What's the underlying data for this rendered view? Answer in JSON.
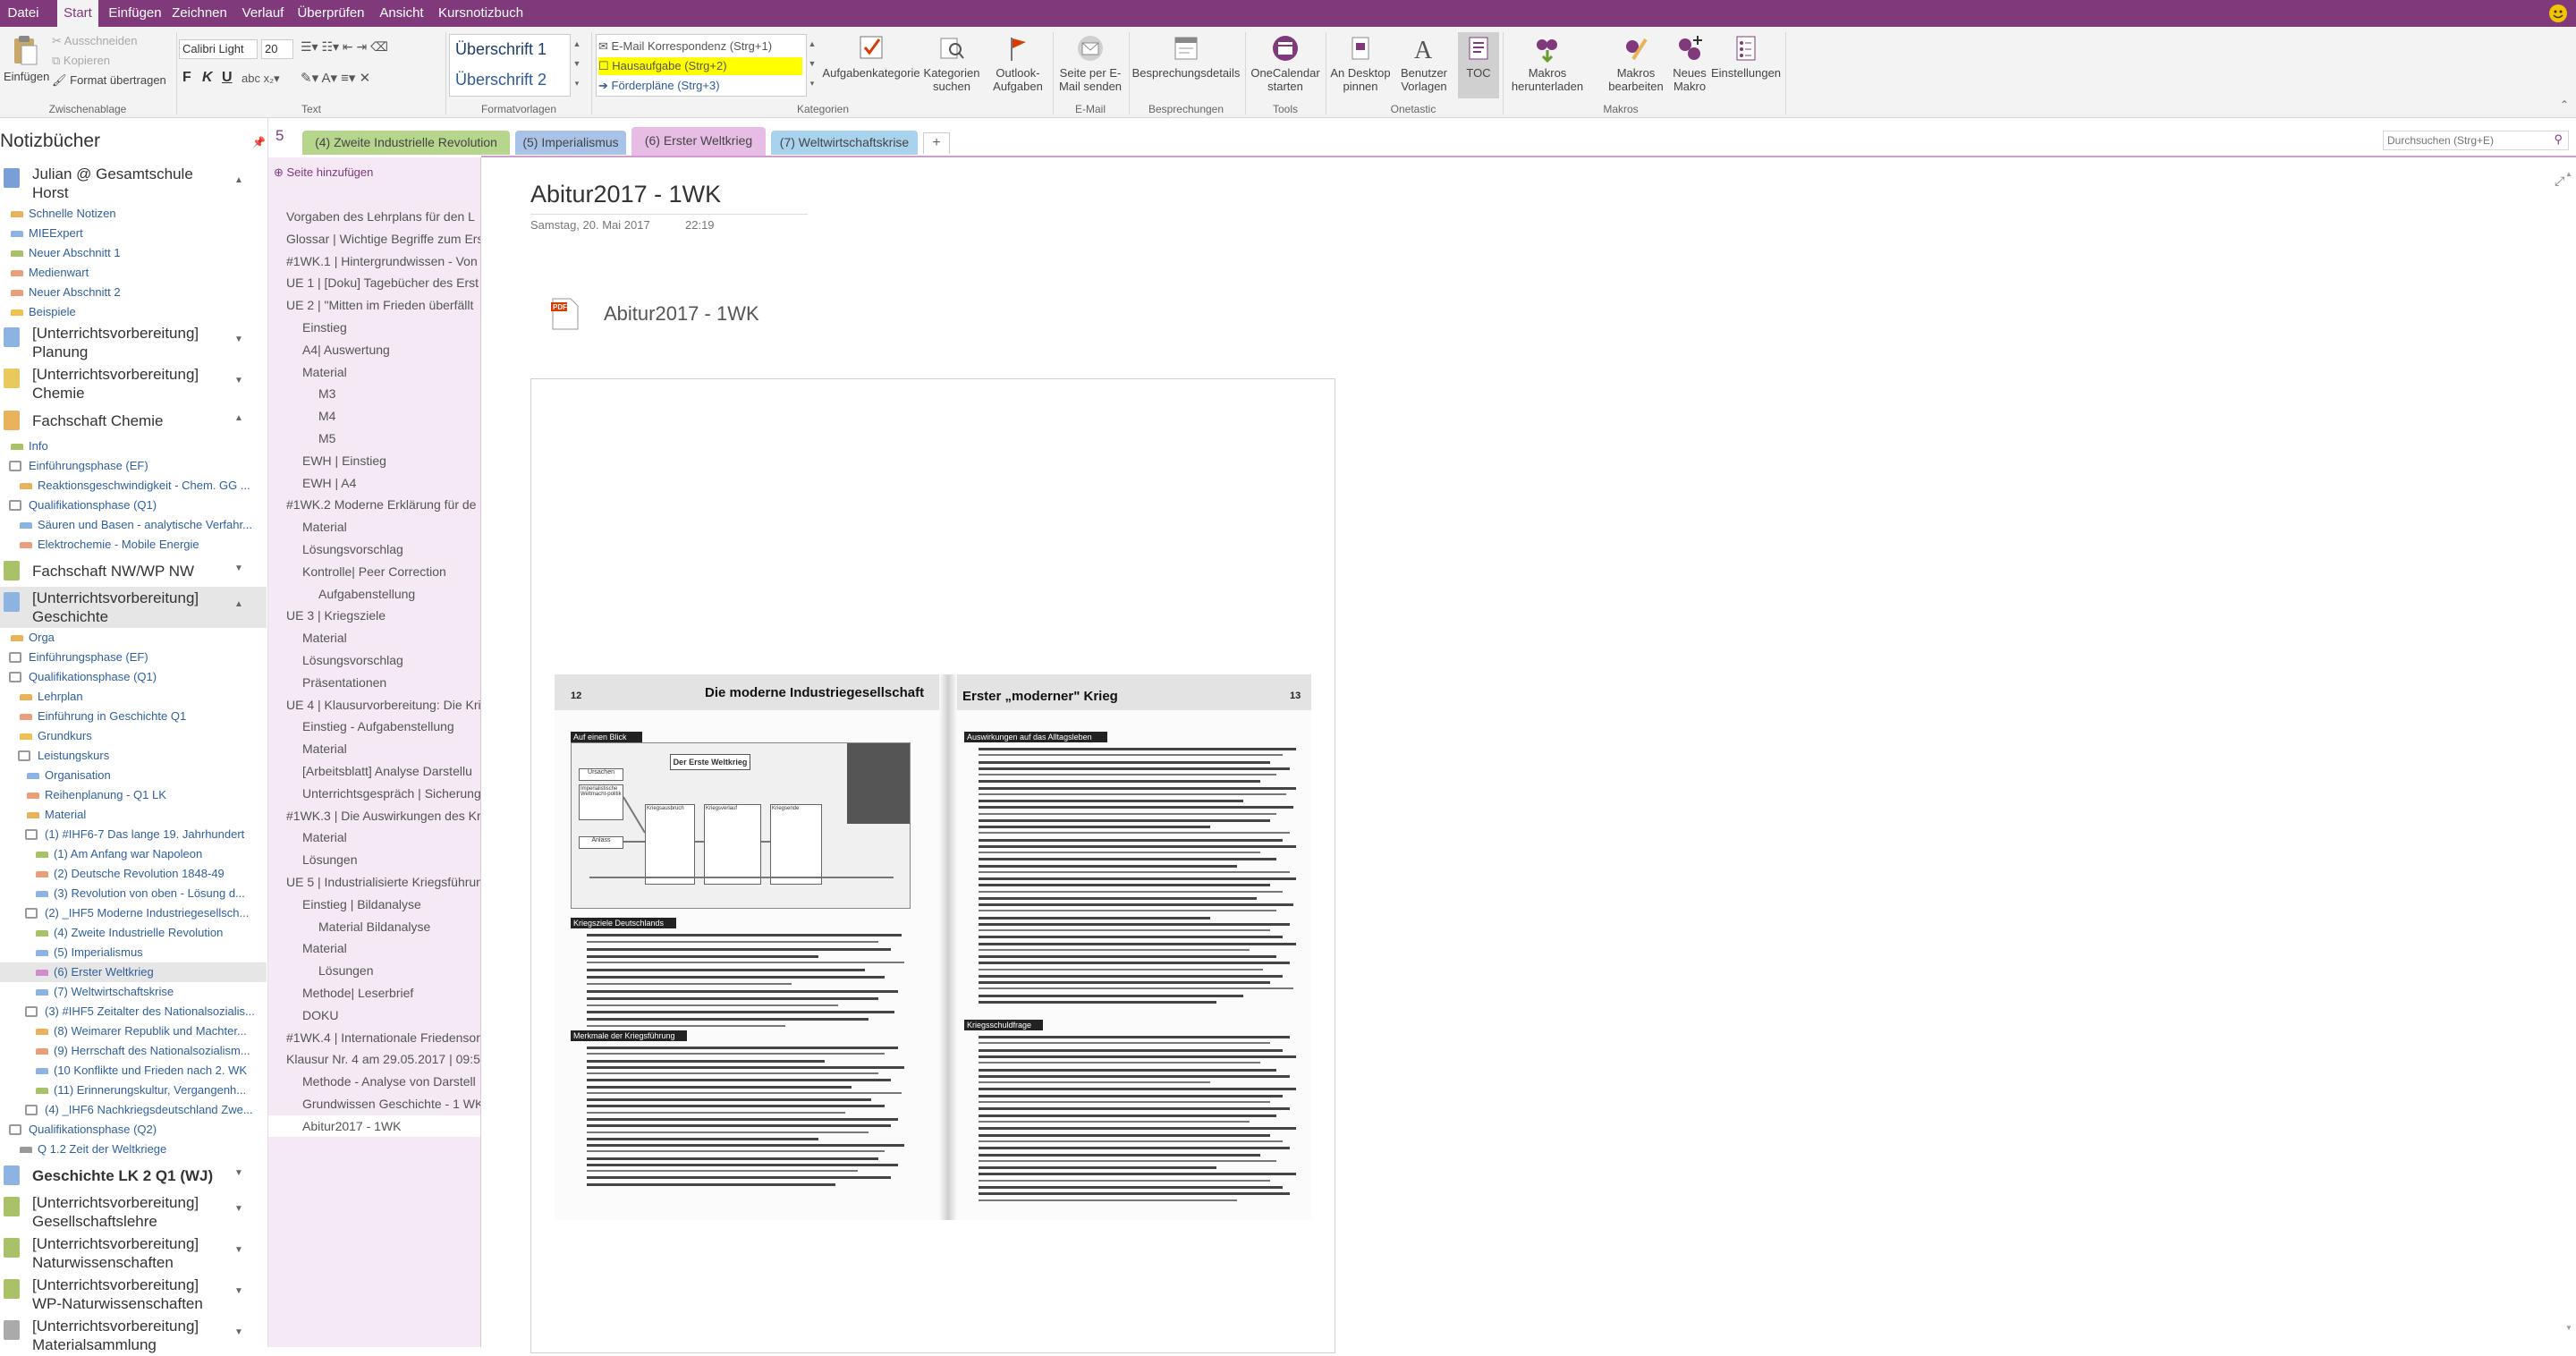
{
  "menu": {
    "tabs": [
      "Datei",
      "Start",
      "Einfügen",
      "Zeichnen",
      "Verlauf",
      "Überprüfen",
      "Ansicht",
      "Kursnotizbuch"
    ]
  },
  "ribbon": {
    "clipboard": {
      "paste": "Einfügen",
      "cut": "Ausschneiden",
      "copy": "Kopieren",
      "format_painter": "Format übertragen",
      "label": "Zwischenablage"
    },
    "text": {
      "font": "Calibri Light",
      "size": "20",
      "label": "Text"
    },
    "styles": {
      "h1": "Überschrift 1",
      "h2": "Überschrift 2",
      "label": "Formatvorlagen"
    },
    "tags": {
      "items": [
        "E-Mail Korrespondenz (Strg+1)",
        "Hausaufgabe (Strg+2)",
        "Förderpläne (Strg+3)"
      ],
      "task_tag": "Aufgabenkategorie",
      "find_tags": "Kategorien suchen",
      "outlook": "Outlook-Aufgaben",
      "label": "Kategorien"
    },
    "email": {
      "send": "Seite per E-Mail senden",
      "label": "E-Mail"
    },
    "meetings": {
      "details": "Besprechungsdetails",
      "label": "Besprechungen"
    },
    "tools": {
      "calendar": "OneCalendar starten",
      "label": "Tools"
    },
    "onetastic": {
      "pin": "An Desktop pinnen",
      "custom": "Benutzer Vorlagen",
      "toc": "TOC",
      "label": "Onetastic"
    },
    "macros": {
      "download": "Makros herunterladen",
      "edit": "Makros bearbeiten",
      "new": "Neues Makro",
      "settings": "Einstellungen",
      "label": "Makros"
    }
  },
  "notebooks": {
    "title": "Notizbücher",
    "items": [
      {
        "label": "Julian @ Gesamtschule Horst",
        "kind": "notebook",
        "color": "#7a9fd6",
        "chev": "▲"
      },
      {
        "label": "Schnelle Notizen",
        "kind": "section",
        "color": "#e9b25d"
      },
      {
        "label": "MIEExpert",
        "kind": "section",
        "color": "#8db3e2"
      },
      {
        "label": "Neuer Abschnitt 1",
        "kind": "section",
        "color": "#a9c26a"
      },
      {
        "label": "Medienwart",
        "kind": "section",
        "color": "#e9a07a"
      },
      {
        "label": "Neuer Abschnitt 2",
        "kind": "section",
        "color": "#e9a07a"
      },
      {
        "label": "Beispiele",
        "kind": "section",
        "color": "#f0c050"
      },
      {
        "label": "[Unterrichtsvorbereitung] Planung",
        "kind": "notebook",
        "color": "#8db3e2",
        "chev": "▼"
      },
      {
        "label": "[Unterrichtsvorbereitung] Chemie",
        "kind": "notebook",
        "color": "#e9c85d",
        "chev": "▼"
      },
      {
        "label": "Fachschaft Chemie",
        "kind": "notebook",
        "color": "#e9b25d",
        "chev": "▲"
      },
      {
        "label": "Info",
        "kind": "section",
        "color": "#a9c26a"
      },
      {
        "label": "Einführungsphase (EF)",
        "kind": "group",
        "color": "#999"
      },
      {
        "label": "Reaktionsgeschwindigkeit - Chem. GG ...",
        "kind": "sub",
        "color": "#e9b25d"
      },
      {
        "label": "Qualifikationsphase (Q1)",
        "kind": "group",
        "color": "#999"
      },
      {
        "label": "Säuren und Basen - analytische Verfahr...",
        "kind": "sub",
        "color": "#8db3e2"
      },
      {
        "label": "Elektrochemie - Mobile Energie",
        "kind": "sub",
        "color": "#e9a07a"
      },
      {
        "label": "Fachschaft NW/WP NW",
        "kind": "notebook",
        "color": "#a9c26a",
        "chev": "▼"
      },
      {
        "label": "[Unterrichtsvorbereitung] Geschichte",
        "kind": "notebook",
        "color": "#8db3e2",
        "chev": "▲"
      },
      {
        "label": "Orga",
        "kind": "section",
        "color": "#e9b25d"
      },
      {
        "label": "Einführungsphase (EF)",
        "kind": "group",
        "color": "#999"
      },
      {
        "label": "Qualifikationsphase (Q1)",
        "kind": "group",
        "color": "#999"
      },
      {
        "label": "Lehrplan",
        "kind": "sub",
        "color": "#e9b25d"
      },
      {
        "label": "Einführung in Geschichte Q1",
        "kind": "sub",
        "color": "#e9a07a"
      },
      {
        "label": "Grundkurs",
        "kind": "sub",
        "color": "#f0c050"
      },
      {
        "label": "Leistungskurs",
        "kind": "subgroup",
        "color": "#999"
      },
      {
        "label": "Organisation",
        "kind": "sub2",
        "color": "#8db3e2"
      },
      {
        "label": "Reihenplanung - Q1 LK",
        "kind": "sub2",
        "color": "#e9a07a"
      },
      {
        "label": "Material",
        "kind": "sub2",
        "color": "#e9b25d"
      },
      {
        "label": "(1) #IHF6-7 Das lange 19. Jahrhundert",
        "kind": "sub2g",
        "color": "#999"
      },
      {
        "label": "(1) Am Anfang war Napoleon",
        "kind": "sub3",
        "color": "#a9c26a"
      },
      {
        "label": "(2) Deutsche Revolution 1848-49",
        "kind": "sub3",
        "color": "#e9a07a"
      },
      {
        "label": "(3) Revolution von oben - Lösung d...",
        "kind": "sub3",
        "color": "#8db3e2"
      },
      {
        "label": "(2) _IHF5 Moderne Industriegesellsch...",
        "kind": "sub2g",
        "color": "#999"
      },
      {
        "label": "(4) Zweite Industrielle Revolution",
        "kind": "sub3",
        "color": "#a9c26a"
      },
      {
        "label": "(5) Imperialismus",
        "kind": "sub3",
        "color": "#8db3e2"
      },
      {
        "label": "(6) Erster Weltkrieg",
        "kind": "sub3",
        "color": "#d08ccf",
        "selected": true
      },
      {
        "label": "(7) Weltwirtschaftskrise",
        "kind": "sub3",
        "color": "#8db3e2"
      },
      {
        "label": "(3) #IHF5 Zeitalter des Nationalsozialis...",
        "kind": "sub2g",
        "color": "#999"
      },
      {
        "label": "(8) Weimarer Republik und Machter...",
        "kind": "sub3",
        "color": "#e9b25d"
      },
      {
        "label": "(9) Herrschaft des Nationalsozialism...",
        "kind": "sub3",
        "color": "#e9a07a"
      },
      {
        "label": "(10 Konflikte und Frieden nach 2. WK",
        "kind": "sub3",
        "color": "#8db3e2"
      },
      {
        "label": "(11) Erinnerungskultur, Vergangenh...",
        "kind": "sub3",
        "color": "#a9c26a"
      },
      {
        "label": "(4) _IHF6 Nachkriegsdeutschland Zwe...",
        "kind": "sub2g",
        "color": "#999"
      },
      {
        "label": "Qualifikationsphase (Q2)",
        "kind": "group",
        "color": "#999"
      },
      {
        "label": "Q 1.2 Zeit der Weltkriege",
        "kind": "sub",
        "color": "#999"
      },
      {
        "label": "Geschichte LK 2 Q1 (WJ)",
        "kind": "notebook",
        "color": "#8db3e2",
        "chev": "▼"
      },
      {
        "label": "[Unterrichtsvorbereitung] Gesellschaftslehre",
        "kind": "notebook",
        "color": "#a9c26a",
        "chev": "▼"
      },
      {
        "label": "[Unterrichtsvorbereitung] Naturwissenschaften",
        "kind": "notebook",
        "color": "#a9c26a",
        "chev": "▼"
      },
      {
        "label": "[Unterrichtsvorbereitung] WP-Naturwissenschaften",
        "kind": "notebook",
        "color": "#a9c26a",
        "chev": "▼"
      },
      {
        "label": "[Unterrichtsvorbereitung] Materialsammlung",
        "kind": "notebook",
        "color": "#aaaaaa",
        "chev": "▼"
      }
    ]
  },
  "section_tabs": [
    {
      "label": "(4) Zweite Industrielle Revolution",
      "color": "#b5d68c"
    },
    {
      "label": "(5) Imperialismus",
      "color": "#a9c2e8"
    },
    {
      "label": "(6) Erster Weltkrieg",
      "color": "#e7bde6",
      "active": true
    },
    {
      "label": "(7) Weltwirtschaftskrise",
      "color": "#a9d2ee"
    }
  ],
  "section_count": "5",
  "add_tab": "+",
  "search": {
    "placeholder": "Durchsuchen (Strg+E)"
  },
  "pages": {
    "add_page": "Seite hinzufügen",
    "items": [
      {
        "label": "Vorgaben des Lehrplans für den L",
        "level": 0
      },
      {
        "label": "Glossar | Wichtige Begriffe zum Ers",
        "level": 0
      },
      {
        "label": "#1WK.1 | Hintergrundwissen - Von",
        "level": 0
      },
      {
        "label": "UE 1 | [Doku] Tagebücher des Erst",
        "level": 0
      },
      {
        "label": "UE 2 | \"Mitten im Frieden überfällt",
        "level": 0
      },
      {
        "label": "Einstieg",
        "level": 1
      },
      {
        "label": "A4| Auswertung",
        "level": 1
      },
      {
        "label": "Material",
        "level": 1
      },
      {
        "label": "M3",
        "level": 2
      },
      {
        "label": "M4",
        "level": 2
      },
      {
        "label": "M5",
        "level": 2
      },
      {
        "label": "EWH | Einstieg",
        "level": 1
      },
      {
        "label": "EWH | A4",
        "level": 1
      },
      {
        "label": "#1WK.2 Moderne Erklärung für de",
        "level": 0
      },
      {
        "label": "Material",
        "level": 1
      },
      {
        "label": "Lösungsvorschlag",
        "level": 1
      },
      {
        "label": "Kontrolle| Peer Correction",
        "level": 1
      },
      {
        "label": "Aufgabenstellung",
        "level": 2
      },
      {
        "label": "UE 3 | Kriegsziele",
        "level": 0
      },
      {
        "label": "Material",
        "level": 1
      },
      {
        "label": "Lösungsvorschlag",
        "level": 1
      },
      {
        "label": "Präsentationen",
        "level": 1
      },
      {
        "label": "UE 4 | Klausurvorbereitung: Die Kri",
        "level": 0
      },
      {
        "label": "Einstieg - Aufgabenstellung",
        "level": 1
      },
      {
        "label": "Material",
        "level": 1
      },
      {
        "label": "[Arbeitsblatt] Analyse Darstellu",
        "level": 1
      },
      {
        "label": "Unterrichtsgespräch | Sicherung",
        "level": 1
      },
      {
        "label": "#1WK.3 | Die Auswirkungen des Kr",
        "level": 0
      },
      {
        "label": "Material",
        "level": 1
      },
      {
        "label": "Lösungen",
        "level": 1
      },
      {
        "label": "UE 5 | Industrialisierte Kriegsführun",
        "level": 0
      },
      {
        "label": "Einstieg | Bildanalyse",
        "level": 1
      },
      {
        "label": "Material Bildanalyse",
        "level": 2
      },
      {
        "label": "Material",
        "level": 1
      },
      {
        "label": "Lösungen",
        "level": 2
      },
      {
        "label": "Methode| Leserbrief",
        "level": 1
      },
      {
        "label": "DOKU",
        "level": 1
      },
      {
        "label": "#1WK.4 | Internationale Friedensor",
        "level": 0
      },
      {
        "label": "Klausur Nr. 4 am 29.05.2017 | 09:5",
        "level": 0
      },
      {
        "label": "Methode - Analyse von Darstell",
        "level": 1
      },
      {
        "label": "Grundwissen Geschichte - 1 WK",
        "level": 1
      },
      {
        "label": "Abitur2017 - 1WK",
        "level": 1,
        "selected": true
      }
    ]
  },
  "page": {
    "title": "Abitur2017 - 1WK",
    "date": "Samstag, 20. Mai 2017",
    "time": "22:19",
    "attachment": "Abitur2017 - 1WK"
  },
  "doc": {
    "left_page_no": "12",
    "left_header": "Die moderne Industriegesellschaft",
    "right_header": "Erster „moderner\" Krieg",
    "right_page_no": "13",
    "box1": "Auf einen Blick",
    "box2": "Kriegsziele Deutschlands",
    "box3": "Merkmale der Kriegsführung",
    "box4": "Auswirkungen auf das Alltagsleben",
    "box5": "Kriegsschuldfrage",
    "diagram_title": "Der Erste Weltkrieg",
    "diag_nodes": [
      "Ursachen",
      "Imperialistische Weltmacht-politik",
      "Anlass",
      "Kriegsausbruch",
      "Kriegsverlauf",
      "Kriegsende"
    ]
  }
}
